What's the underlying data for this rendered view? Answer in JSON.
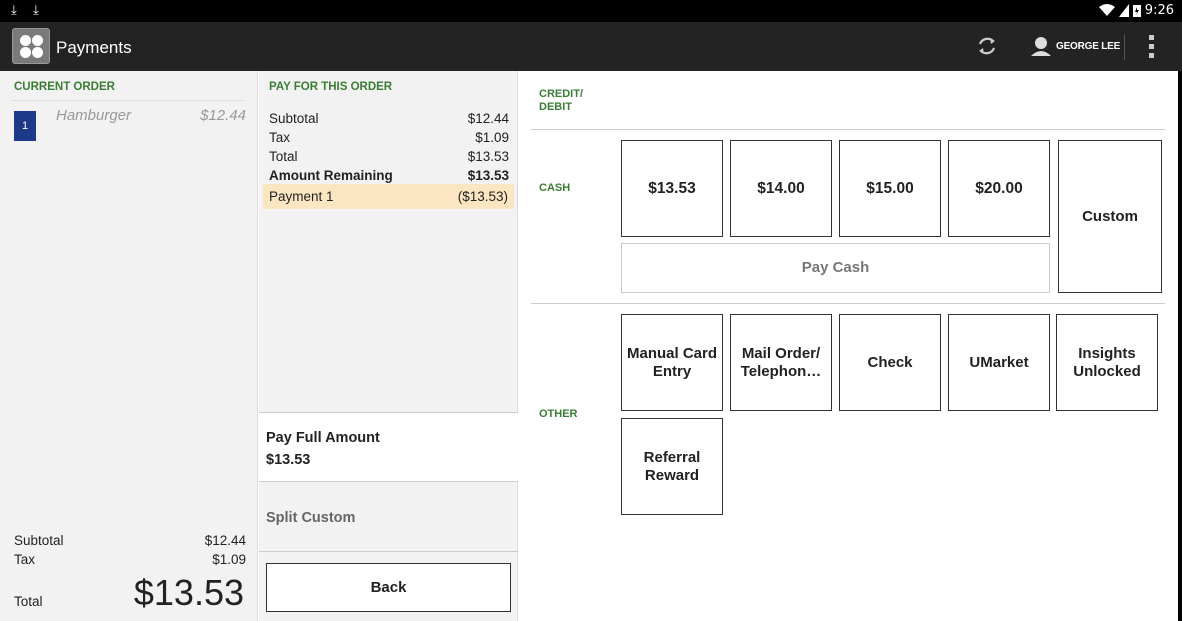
{
  "status_bar": {
    "time": "9:26"
  },
  "action_bar": {
    "title": "Payments",
    "user_name": "GEORGE LEE"
  },
  "current_order": {
    "heading": "CURRENT ORDER",
    "items": [
      {
        "qty": "1",
        "name": "Hamburger",
        "price": "$12.44"
      }
    ],
    "subtotal_label": "Subtotal",
    "subtotal_value": "$12.44",
    "tax_label": "Tax",
    "tax_value": "$1.09",
    "total_label": "Total",
    "total_value": "$13.53"
  },
  "pay_for_order": {
    "heading": "PAY FOR THIS ORDER",
    "rows": [
      {
        "label": "Subtotal",
        "value": "$12.44"
      },
      {
        "label": "Tax",
        "value": "$1.09"
      },
      {
        "label": "Total",
        "value": "$13.53"
      },
      {
        "label": "Amount Remaining",
        "value": "$13.53"
      }
    ],
    "payment": {
      "label": "Payment 1",
      "value": "($13.53)"
    },
    "pay_full_label": "Pay Full Amount",
    "pay_full_value": "$13.53",
    "split_custom_label": "Split Custom",
    "back_label": "Back"
  },
  "payment_methods": {
    "credit_label": "CREDIT/\nDEBIT",
    "cash_label": "CASH",
    "cash_amounts": [
      "$13.53",
      "$14.00",
      "$15.00",
      "$20.00"
    ],
    "custom_label": "Custom",
    "pay_cash_label": "Pay Cash",
    "other_label": "OTHER",
    "other_options": [
      "Manual Card Entry",
      "Mail Order/ Telephon…",
      "Check",
      "UMarket",
      "Insights Unlocked",
      "Referral Reward"
    ]
  },
  "colors": {
    "accent_green": "#3a7d34",
    "qty_badge": "#1d3a8a",
    "payment_highlight": "#fce5c1",
    "action_bar": "#232323"
  }
}
